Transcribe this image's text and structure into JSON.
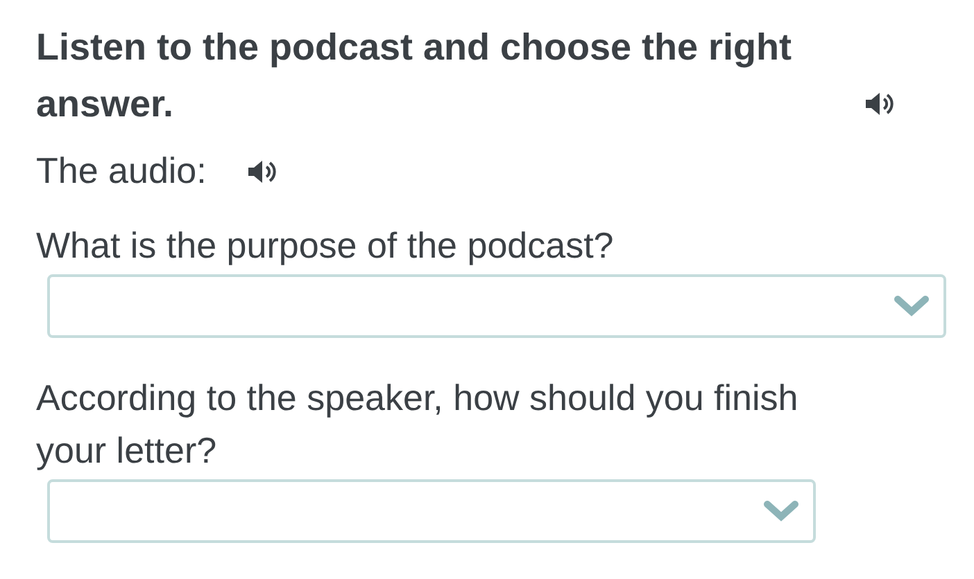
{
  "instruction": {
    "text": "Listen to the podcast and choose the right answer."
  },
  "audio": {
    "label": "The audio:"
  },
  "questions": [
    {
      "text": "What is the purpose of the podcast?"
    },
    {
      "text": "According to the speaker, how should you finish your letter?"
    }
  ]
}
